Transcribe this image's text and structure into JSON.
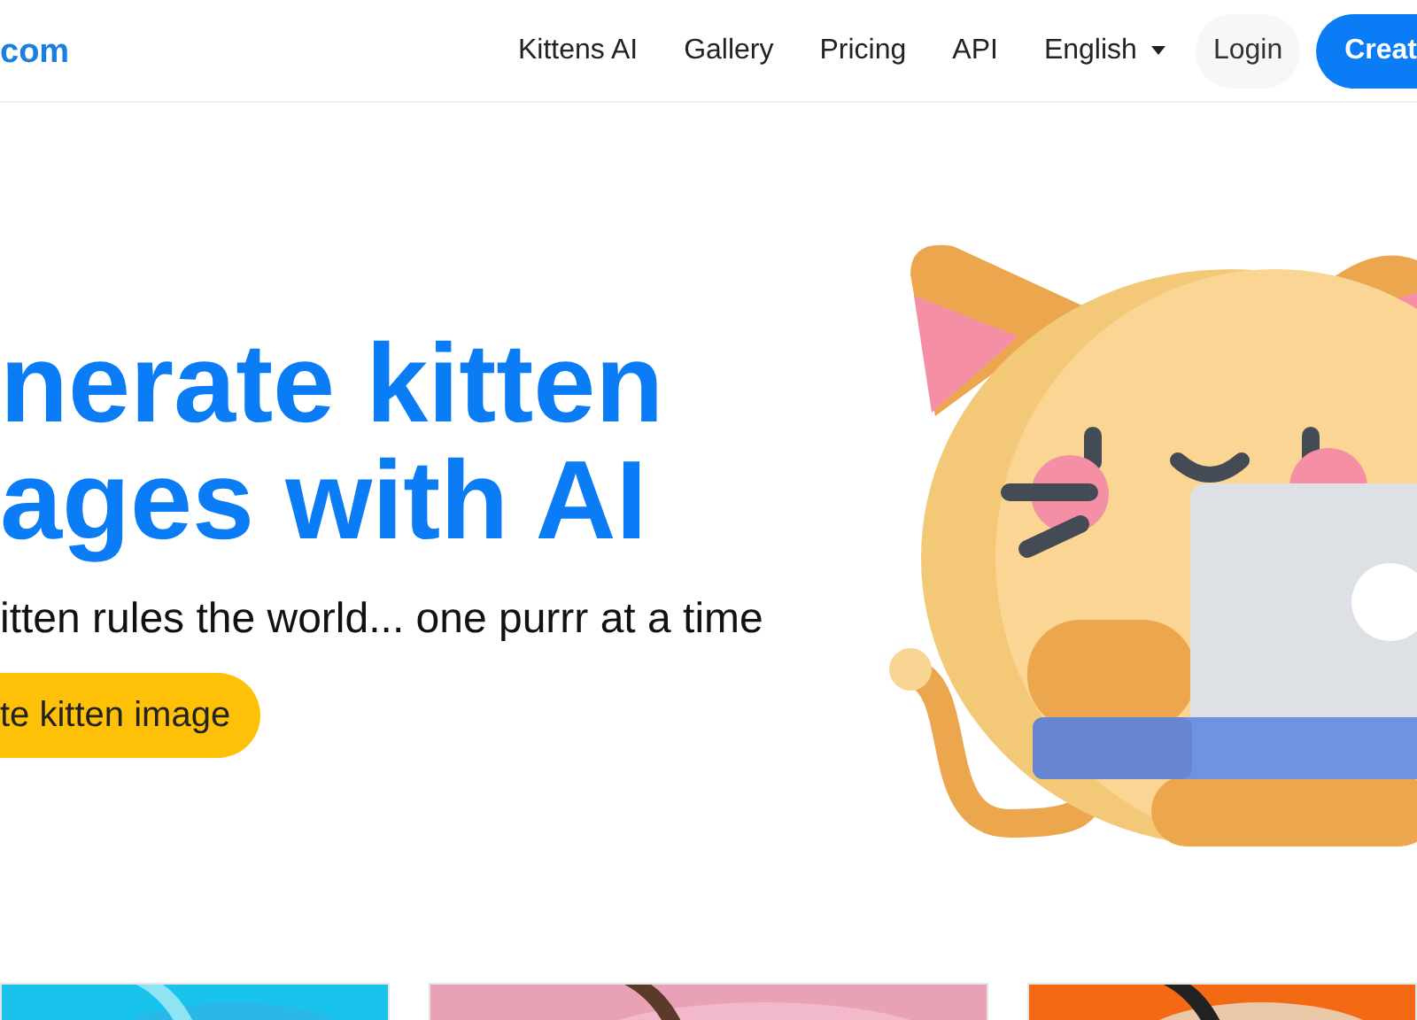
{
  "header": {
    "logo": "com",
    "nav": [
      {
        "kind": "link",
        "label": "Kittens AI"
      },
      {
        "kind": "link",
        "label": "Gallery"
      },
      {
        "kind": "link",
        "label": "Pricing"
      },
      {
        "kind": "link",
        "label": "API"
      },
      {
        "kind": "dropdown",
        "label": "English"
      }
    ],
    "login": "Login",
    "create": "Creat"
  },
  "hero": {
    "title_lines": [
      "nerate kitten",
      "ages with AI"
    ],
    "subtitle": "itten rules the world... one purrr at a time",
    "cta": "te kitten image"
  }
}
